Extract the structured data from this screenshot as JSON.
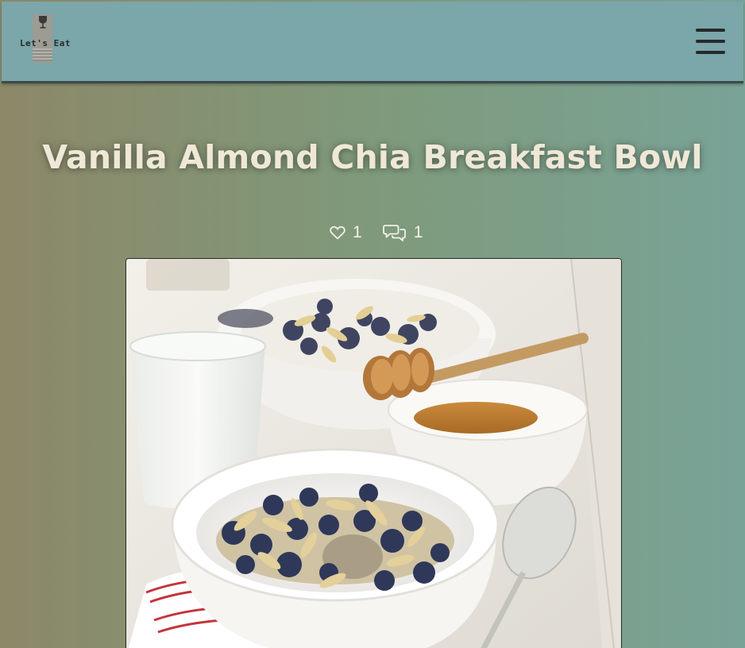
{
  "app": {
    "logo_text": "Let's Eat"
  },
  "header": {
    "menu_icon": "hamburger-menu-icon"
  },
  "recipe": {
    "title": "Vanilla Almond Chia Breakfast Bowl",
    "likes": "1",
    "comments": "1",
    "like_icon": "heart-icon",
    "comment_icon": "comments-icon"
  },
  "colors": {
    "header_bg": "#7ba6aa",
    "title_text": "#efe8d6",
    "background_left": "#8c8868",
    "background_right": "#79a397"
  }
}
